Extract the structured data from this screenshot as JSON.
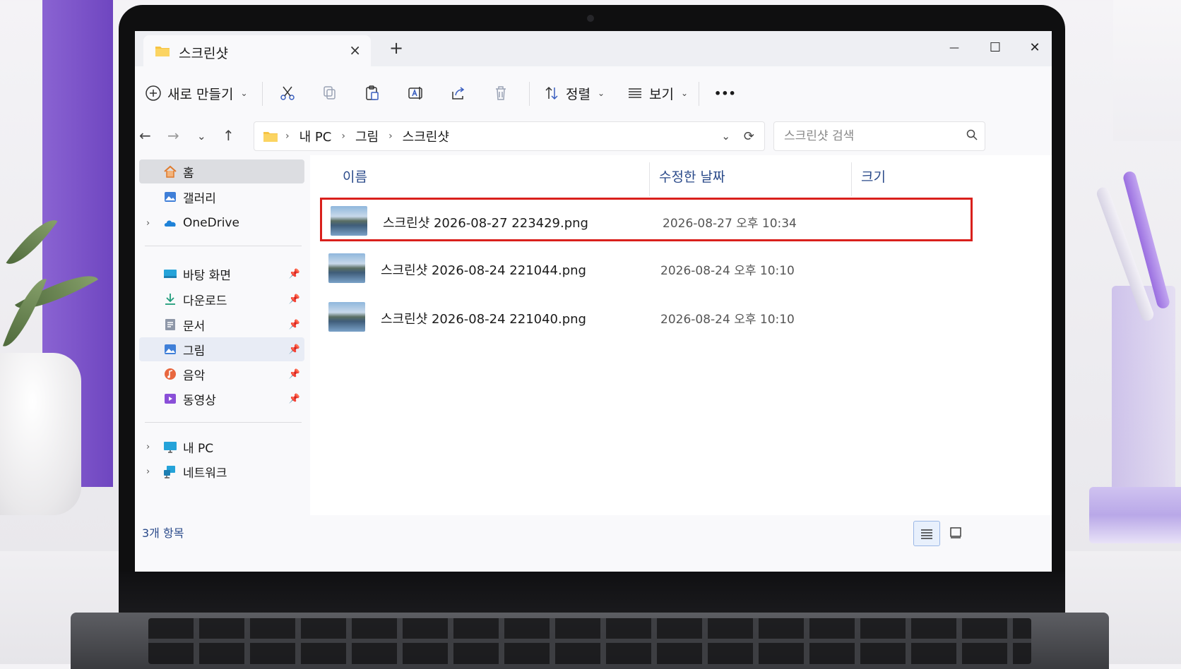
{
  "window": {
    "tab_title": "스크린샷",
    "tab_close_icon": "×",
    "new_tab_icon": "+",
    "minimize_icon": "—",
    "maximize_icon": "☐",
    "close_icon": "✕"
  },
  "toolbar": {
    "new_label": "새로 만들기",
    "sort_label": "정렬",
    "view_label": "보기",
    "more_label": "•••"
  },
  "address": {
    "crumbs": [
      "내 PC",
      "그림",
      "스크린샷"
    ],
    "search_placeholder": "스크린샷 검색"
  },
  "sidebar": {
    "items": [
      {
        "label": "홈",
        "icon": "home-icon"
      },
      {
        "label": "갤러리",
        "icon": "gallery-icon"
      },
      {
        "label": "OneDrive",
        "icon": "onedrive-icon"
      },
      {
        "label": "바탕 화면",
        "icon": "desktop-icon"
      },
      {
        "label": "다운로드",
        "icon": "download-icon"
      },
      {
        "label": "문서",
        "icon": "documents-icon"
      },
      {
        "label": "그림",
        "icon": "pictures-icon"
      },
      {
        "label": "음악",
        "icon": "music-icon"
      },
      {
        "label": "동영상",
        "icon": "videos-icon"
      },
      {
        "label": "내 PC",
        "icon": "pc-icon"
      },
      {
        "label": "네트워크",
        "icon": "network-icon"
      }
    ]
  },
  "columns": {
    "name": "이름",
    "date": "수정한 날짜",
    "size": "크기"
  },
  "files": [
    {
      "name": "스크린샷 2026-08-27 223429.png",
      "date": "2026-08-27 오후 10:34"
    },
    {
      "name": "스크린샷 2026-08-24 221044.png",
      "date": "2026-08-24 오후 10:10"
    },
    {
      "name": "스크린샷 2026-08-24 221040.png",
      "date": "2026-08-24 오후 10:10"
    }
  ],
  "status": {
    "count": "3개 항목"
  },
  "colors": {
    "highlight": "#d9201c",
    "accent": "#2a4a8a"
  }
}
